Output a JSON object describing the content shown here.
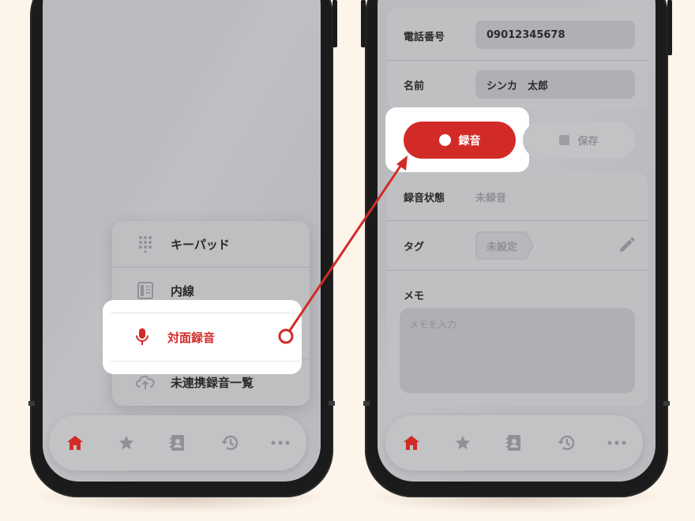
{
  "colors": {
    "accent": "#d22b27",
    "background": "#fdf4ea",
    "screen_overlay": "#b9bbbe"
  },
  "left_phone": {
    "menu": {
      "items": [
        {
          "label": "キーパッド",
          "icon": "keypad-icon"
        },
        {
          "label": "内線",
          "icon": "extension-phone-icon"
        },
        {
          "label": "対面録音",
          "icon": "microphone-icon"
        },
        {
          "label": "未連携録音一覧",
          "icon": "cloud-upload-icon"
        }
      ]
    },
    "nav": [
      "home-icon",
      "star-icon",
      "contacts-icon",
      "history-icon",
      "more-icon"
    ]
  },
  "right_phone": {
    "phone_label": "電話番号",
    "phone_value": "09012345678",
    "name_label": "名前",
    "name_value": "シンカ　太郎",
    "record_button": "録音",
    "save_button": "保存",
    "status_label": "録音状態",
    "status_value": "未録音",
    "tag_label": "タグ",
    "tag_value": "未設定",
    "memo_label": "メモ",
    "memo_placeholder": "メモを入力",
    "nav": [
      "home-icon",
      "star-icon",
      "contacts-icon",
      "history-icon",
      "more-icon"
    ]
  }
}
